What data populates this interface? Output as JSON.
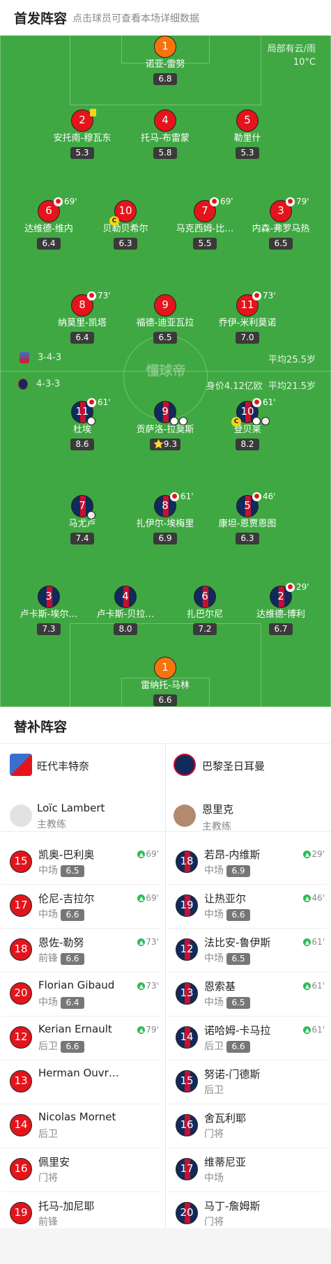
{
  "header": {
    "title": "首发阵容",
    "subtitle": "点击球员可查看本场详细数据"
  },
  "weather": {
    "condition": "局部有云/雨",
    "temperature": "10°C"
  },
  "brand": "懂球帝",
  "home_team": {
    "formation": "3-4-3",
    "avg_age": "平均25.5岁",
    "color": "#e3141b"
  },
  "away_team": {
    "formation": "4-3-3",
    "value": "身价4.12亿欧",
    "avg_age": "平均21.5岁",
    "color": "#102a5c"
  },
  "home_lineup": [
    {
      "num": "1",
      "name": "诺亚-雷努",
      "rating": "6.8",
      "gk": true
    },
    {
      "num": "2",
      "name": "安托南-穆瓦东",
      "rating": "5.3",
      "yellow": true
    },
    {
      "num": "4",
      "name": "托马-布雷蒙",
      "rating": "5.8"
    },
    {
      "num": "5",
      "name": "勒里什",
      "rating": "5.3"
    },
    {
      "num": "6",
      "name": "达维德-维内",
      "rating": "6.4",
      "sub": "69'"
    },
    {
      "num": "10",
      "name": "贝勒贝希尔",
      "rating": "6.3",
      "captain": "C"
    },
    {
      "num": "7",
      "name": "马克西姆-比…",
      "rating": "5.5",
      "sub": "69'"
    },
    {
      "num": "3",
      "name": "内森-弗罗马热",
      "rating": "6.5",
      "sub": "79'"
    },
    {
      "num": "8",
      "name": "纳莫里-凯塔",
      "rating": "6.4",
      "sub": "73'"
    },
    {
      "num": "9",
      "name": "福德-迪亚瓦拉",
      "rating": "6.5"
    },
    {
      "num": "11",
      "name": "乔伊-米利莫诺",
      "rating": "7.0",
      "sub": "73'"
    }
  ],
  "away_lineup": [
    {
      "num": "11",
      "name": "杜埃",
      "rating": "8.6",
      "sub": "61'",
      "goals": 1
    },
    {
      "num": "9",
      "name": "贡萨洛-拉莫斯",
      "rating": "9.3",
      "goals": 2,
      "star": "⭐"
    },
    {
      "num": "10",
      "name": "登贝莱",
      "rating": "8.2",
      "sub": "61'",
      "captain": "C",
      "goals": 1,
      "assists": 1
    },
    {
      "num": "7",
      "name": "马尤卢",
      "rating": "7.4",
      "assists": 1
    },
    {
      "num": "8",
      "name": "扎伊尔-埃梅里",
      "rating": "6.9",
      "sub": "61'"
    },
    {
      "num": "5",
      "name": "康坦-恩贾恩图",
      "rating": "6.3",
      "sub": "46'"
    },
    {
      "num": "3",
      "name": "卢卡斯-埃尔…",
      "rating": "7.3"
    },
    {
      "num": "4",
      "name": "卢卡斯-贝拉…",
      "rating": "8.0"
    },
    {
      "num": "6",
      "name": "扎巴尔尼",
      "rating": "7.2"
    },
    {
      "num": "2",
      "name": "达维德-博利",
      "rating": "6.7",
      "sub": "29'"
    },
    {
      "num": "1",
      "name": "雷纳托-马林",
      "rating": "6.6",
      "gk": true
    }
  ],
  "subs_section": {
    "title": "替补阵容"
  },
  "home_bench": {
    "team_name": "旺代丰特奈",
    "coach_name": "Loïc Lambert",
    "coach_role": "主教练",
    "players": [
      {
        "num": "15",
        "name": "凯奥-巴利奥",
        "pos": "中场",
        "rating": "6.5",
        "in": "69'"
      },
      {
        "num": "17",
        "name": "伦尼-吉拉尔",
        "pos": "中场",
        "rating": "6.6",
        "in": "69'"
      },
      {
        "num": "18",
        "name": "恩佐-勒努",
        "pos": "前锋",
        "rating": "6.6",
        "in": "73'"
      },
      {
        "num": "20",
        "name": "Florian Gibaud",
        "pos": "中场",
        "rating": "6.4",
        "in": "73'"
      },
      {
        "num": "12",
        "name": "Kerian Ernault",
        "pos": "后卫",
        "rating": "6.6",
        "in": "79'"
      },
      {
        "num": "13",
        "name": "Herman Ouvr…",
        "pos": "",
        "rating": "",
        "in": ""
      },
      {
        "num": "14",
        "name": "Nicolas Mornet",
        "pos": "后卫",
        "rating": "",
        "in": ""
      },
      {
        "num": "16",
        "name": "佩里安",
        "pos": "门将",
        "rating": "",
        "in": ""
      },
      {
        "num": "19",
        "name": "托马-加尼耶",
        "pos": "前锋",
        "rating": "",
        "in": ""
      }
    ]
  },
  "away_bench": {
    "team_name": "巴黎圣日耳曼",
    "coach_name": "恩里克",
    "coach_role": "主教练",
    "players": [
      {
        "num": "18",
        "name": "若昂-内维斯",
        "pos": "中场",
        "rating": "6.9",
        "in": "29'"
      },
      {
        "num": "19",
        "name": "让热亚尔",
        "pos": "中场",
        "rating": "6.6",
        "in": "46'"
      },
      {
        "num": "12",
        "name": "法比安-鲁伊斯",
        "pos": "中场",
        "rating": "6.5",
        "in": "61'"
      },
      {
        "num": "13",
        "name": "恩索基",
        "pos": "中场",
        "rating": "6.5",
        "in": "61'"
      },
      {
        "num": "14",
        "name": "诺哈姆-卡马拉",
        "pos": "后卫",
        "rating": "6.6",
        "in": "61'"
      },
      {
        "num": "15",
        "name": "努诺-门德斯",
        "pos": "后卫",
        "rating": "",
        "in": ""
      },
      {
        "num": "16",
        "name": "舍瓦利耶",
        "pos": "门将",
        "rating": "",
        "in": ""
      },
      {
        "num": "17",
        "name": "维蒂尼亚",
        "pos": "中场",
        "rating": "",
        "in": ""
      },
      {
        "num": "20",
        "name": "马丁-詹姆斯",
        "pos": "门将",
        "rating": "",
        "in": ""
      }
    ]
  }
}
